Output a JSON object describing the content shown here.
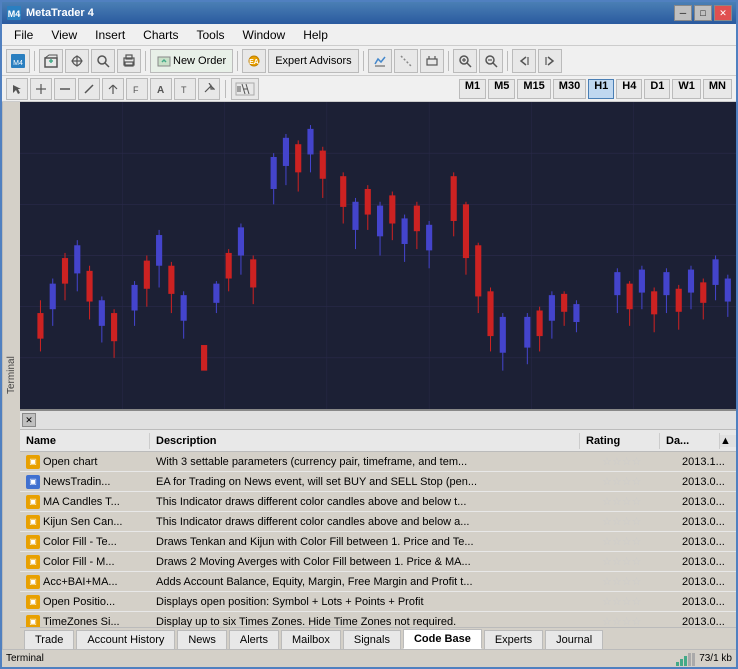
{
  "window": {
    "title": "MetaTrader 4",
    "icon": "MT4"
  },
  "menu": {
    "items": [
      "File",
      "View",
      "Insert",
      "Charts",
      "Tools",
      "Window",
      "Help"
    ]
  },
  "toolbar": {
    "new_order": "New Order",
    "expert_advisors": "Expert Advisors"
  },
  "timeframes": [
    "M1",
    "M5",
    "M15",
    "M30",
    "H1",
    "H4",
    "D1",
    "W1",
    "MN"
  ],
  "active_timeframe": "H1",
  "table": {
    "columns": [
      "Name",
      "Description",
      "Rating",
      "Da..."
    ],
    "rows": [
      {
        "icon": "yellow",
        "name": "Open chart",
        "description": "With 3 settable parameters (currency pair, timeframe, and tem...",
        "rating": "☆☆☆☆",
        "date": "2013.1...",
        "type": "chart"
      },
      {
        "icon": "blue",
        "name": "NewsTradin...",
        "description": "EA for Trading on News event, will set BUY and SELL Stop (pen...",
        "rating": "☆☆☆☆",
        "date": "2013.0...",
        "type": "ea"
      },
      {
        "icon": "yellow",
        "name": "MA Candles T...",
        "description": "This Indicator draws different color candles above and below t...",
        "rating": "☆☆☆☆",
        "date": "2013.0...",
        "type": "indicator"
      },
      {
        "icon": "yellow",
        "name": "Kijun Sen Can...",
        "description": "This Indicator draws different color candles above and below a...",
        "rating": "☆☆☆☆",
        "date": "2013.0...",
        "type": "indicator"
      },
      {
        "icon": "yellow",
        "name": "Color Fill - Te...",
        "description": "Draws Tenkan and Kijun with Color Fill between 1. Price and Te...",
        "rating": "☆☆☆☆",
        "date": "2013.0...",
        "type": "indicator"
      },
      {
        "icon": "yellow",
        "name": "Color Fill - M...",
        "description": "Draws 2 Moving Averges with Color Fill between 1. Price & MA...",
        "rating": "☆☆☆☆",
        "date": "2013.0...",
        "type": "indicator"
      },
      {
        "icon": "yellow",
        "name": "Acc+BAI+MA...",
        "description": "Adds Account Balance, Equity, Margin, Free Margin and Profit t...",
        "rating": "☆☆☆☆",
        "date": "2013.0...",
        "type": "indicator"
      },
      {
        "icon": "yellow",
        "name": "Open Positio...",
        "description": "Displays open position: Symbol + Lots + Points + Profit",
        "rating": "☆☆☆☆",
        "date": "2013.0...",
        "type": "indicator"
      },
      {
        "icon": "yellow",
        "name": "TimeZones Si...",
        "description": "Display up to six Times Zones. Hide Time Zones not required.",
        "rating": "☆☆☆☆",
        "date": "2013.0...",
        "type": "indicator"
      }
    ]
  },
  "tabs": [
    {
      "label": "Trade",
      "active": false
    },
    {
      "label": "Account History",
      "active": false
    },
    {
      "label": "News",
      "active": false
    },
    {
      "label": "Alerts",
      "active": false
    },
    {
      "label": "Mailbox",
      "active": false
    },
    {
      "label": "Signals",
      "active": false
    },
    {
      "label": "Code Base",
      "active": true
    },
    {
      "label": "Experts",
      "active": false
    },
    {
      "label": "Journal",
      "active": false
    }
  ],
  "status": {
    "left": "Terminal",
    "right": "73/1 kb"
  },
  "colors": {
    "chart_bg": "#1c2035",
    "bull_candle": "#4444cc",
    "bear_candle": "#cc2222",
    "grid": "#2a2a4a"
  }
}
